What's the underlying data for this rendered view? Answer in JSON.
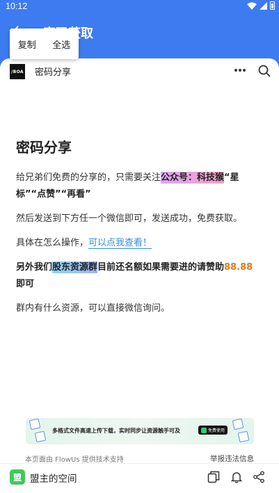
{
  "status_bar": {
    "time": "10:12"
  },
  "header": {
    "title": "密码获取"
  },
  "context_menu": {
    "copy": "复制",
    "select_all": "全选"
  },
  "page_bar": {
    "logo_text": "/BOA",
    "name": "密码分享"
  },
  "article": {
    "title": "密码分享",
    "p1_a": "给兄弟们免费的分享的，只需要关注",
    "p1_highlight": "公众号：科技猴",
    "p1_b": "“星标”“点赞”“再看”",
    "p2": "然后发送到下方任一个微信即可，发送成功，免费获取。",
    "p3_a": "具体在怎么操作，",
    "p3_link": "可以点我查看！",
    "p4_a": "另外我们",
    "p4_highlight": "股东资源群",
    "p4_b": "目前还名额如果需要进的请赞助",
    "p4_amount": "88.88",
    "p4_c": "即可",
    "p5": "群内有什么资源，可以直接微信询问。"
  },
  "banner": {
    "text": "多格式文件高速上传下载，实时同步让资源触手可及",
    "button": "免费使用"
  },
  "footer": {
    "powered": "本页面由 FlowUs 提供技术支持",
    "report": "举报违法信息"
  },
  "bottom_bar": {
    "avatar_char": "盟",
    "account_name": "盟主的空间"
  },
  "colors": {
    "header_blue": "#3d7bf0",
    "link_blue": "#2f8de0",
    "amount_orange": "#e07a1a",
    "avatar_green": "#3ec95b"
  }
}
